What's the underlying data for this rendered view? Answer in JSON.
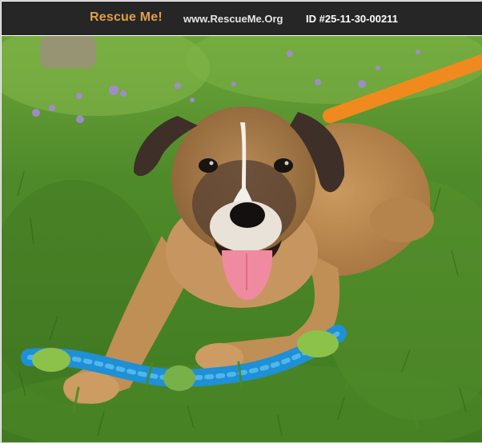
{
  "header": {
    "brand": "Rescue Me!",
    "site": "www.RescueMe.Org",
    "pet_id": "ID #25-11-30-00211"
  },
  "photo": {
    "subject": "dog-photo",
    "colors": {
      "header_bg": "#262626",
      "brand": "#e0a045",
      "grass": "#4f8a2a",
      "leash": "#f08a1e",
      "toy_rope": "#1f8fd6"
    }
  }
}
